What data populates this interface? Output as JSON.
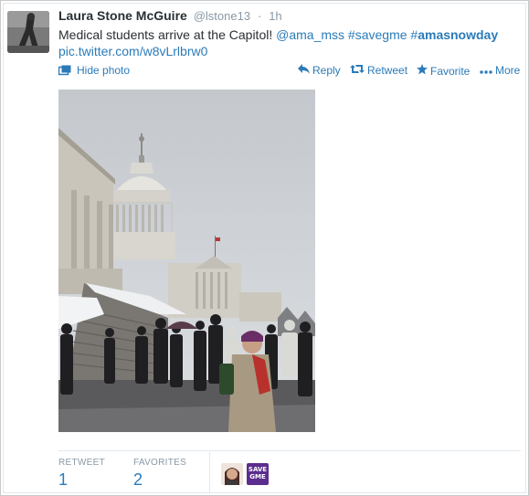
{
  "tweet": {
    "author": {
      "fullname": "Laura Stone McGuire",
      "username": "@lstone13",
      "separator": "·",
      "time": "1h"
    },
    "text_plain": "Medical students arrive at the Capitol! ",
    "mention": "@ama_mss",
    "hashtag1": "#savegme",
    "hashtag2_prefix": "#",
    "hashtag2_bold": "amasnowday",
    "link": "pic.twitter.com/w8vLrlbrw0"
  },
  "actions": {
    "hide_photo": "Hide photo",
    "reply": "Reply",
    "retweet": "Retweet",
    "favorite": "Favorite",
    "more": "More"
  },
  "stats": {
    "retweet_label": "RETWEET",
    "retweet_count": "1",
    "favorites_label": "FAVORITES",
    "favorites_count": "2"
  },
  "favoriter_badge": "SAVE GME",
  "colors": {
    "link": "#2b7bb9",
    "muted": "#8899a6",
    "text": "#292f33"
  },
  "icons": [
    "photo-icon",
    "reply-icon",
    "retweet-icon",
    "favorite-star-icon",
    "more-dots-icon"
  ]
}
